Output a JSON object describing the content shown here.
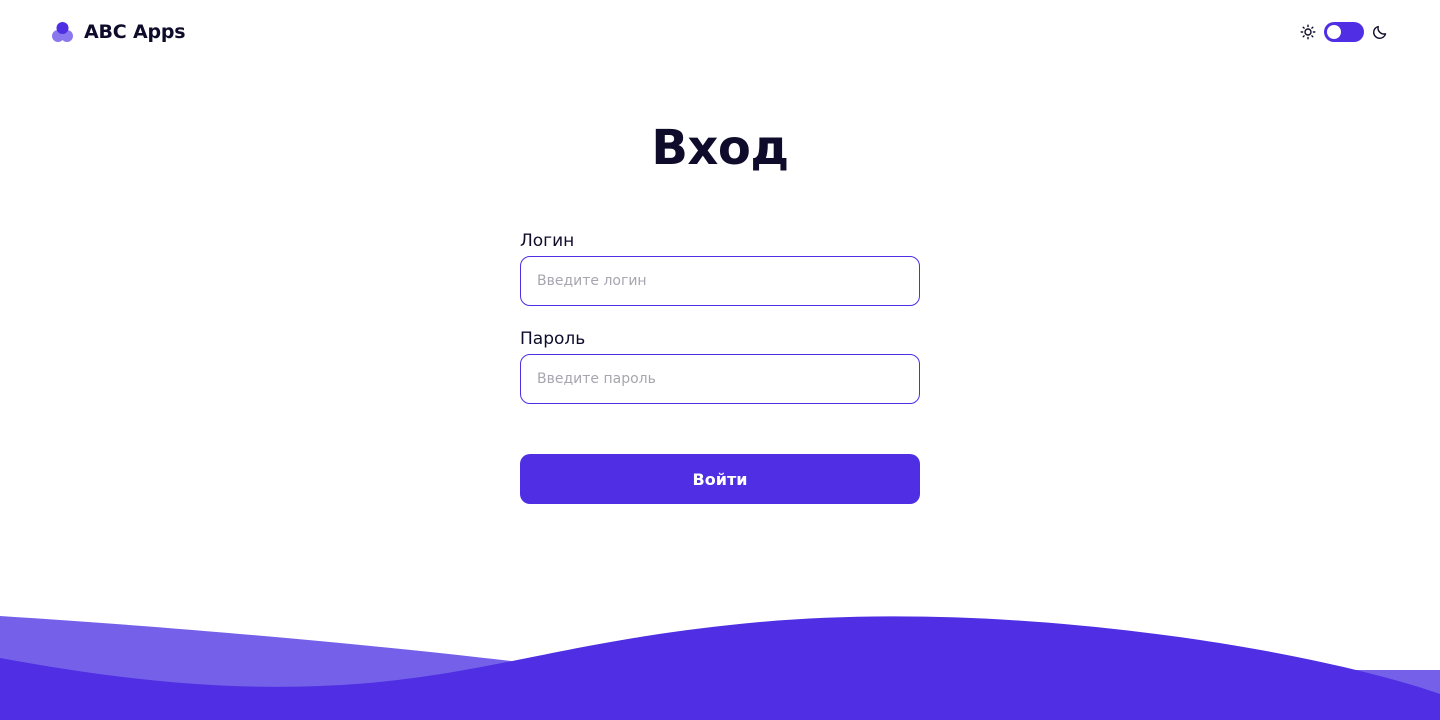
{
  "header": {
    "brand_name": "ABC Apps",
    "logo_icon": "abc-apps-logo",
    "theme_toggle": {
      "light_icon": "sun-icon",
      "dark_icon": "moon-icon",
      "state": "light"
    }
  },
  "main": {
    "title": "Вход",
    "login": {
      "label": "Логин",
      "placeholder": "Введите логин",
      "value": ""
    },
    "password": {
      "label": "Пароль",
      "placeholder": "Введите пароль",
      "value": ""
    },
    "submit_label": "Войти"
  },
  "colors": {
    "accent": "#4f2ee3",
    "accent_light": "#7560ea",
    "text": "#0f0c2b",
    "placeholder": "#a7a6b0",
    "background": "#ffffff"
  }
}
